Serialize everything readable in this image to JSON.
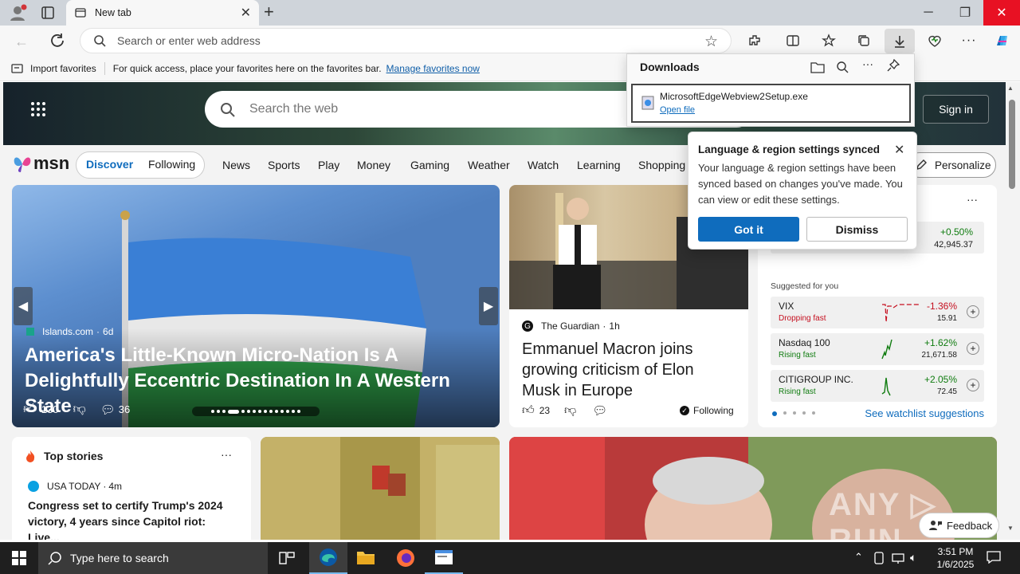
{
  "browser": {
    "tab_title": "New tab",
    "address_placeholder": "Search or enter web address",
    "import_favorites": "Import favorites",
    "favorites_hint": "For quick access, place your favorites here on the favorites bar.",
    "manage_favorites": "Manage favorites now"
  },
  "downloads": {
    "title": "Downloads",
    "file_name": "MicrosoftEdgeWebview2Setup.exe",
    "open_file": "Open file"
  },
  "sync_popup": {
    "title": "Language & region settings synced",
    "body": "Your language & region settings have been synced based on changes you've made. You can view or edit these settings.",
    "got_it": "Got it",
    "dismiss": "Dismiss"
  },
  "msn": {
    "search_placeholder": "Search the web",
    "sign_in": "Sign in",
    "logo": "msn",
    "tabs": [
      "Discover",
      "Following"
    ],
    "nav": [
      "News",
      "Sports",
      "Play",
      "Money",
      "Gaming",
      "Weather",
      "Watch",
      "Learning",
      "Shopping"
    ],
    "personalize": "Personalize"
  },
  "hero_card": {
    "source": "Islands.com",
    "age": "6d",
    "headline": "America's Little-Known Micro-Nation Is A Delightfully Eccentric Destination In A Western State",
    "likes": "130",
    "comments": "36"
  },
  "story_card": {
    "source": "The Guardian",
    "age": "1h",
    "headline": "Emmanuel Macron joins growing criticism of Elon Musk in Europe",
    "likes": "23",
    "following": "Following"
  },
  "watchlist": {
    "top_change": "+0.50%",
    "top_value": "42,945.37",
    "suggested": "Suggested for you",
    "stocks": [
      {
        "name": "VIX",
        "status": "Dropping fast",
        "change": "-1.36%",
        "value": "15.91"
      },
      {
        "name": "Nasdaq 100",
        "status": "Rising fast",
        "change": "+1.62%",
        "value": "21,671.58"
      },
      {
        "name": "CITIGROUP INC.",
        "status": "Rising fast",
        "change": "+2.05%",
        "value": "72.45"
      }
    ],
    "see_suggestions": "See watchlist suggestions"
  },
  "top_stories": {
    "title": "Top stories",
    "source": "USA TODAY",
    "age": "4m",
    "headline": "Congress set to certify Trump's 2024 victory, 4 years since Capitol riot: Live..."
  },
  "feedback": "Feedback",
  "taskbar": {
    "search_placeholder": "Type here to search",
    "time": "3:51 PM",
    "date": "1/6/2025"
  },
  "colors": {
    "accent": "#0f6cbd",
    "positive": "#107c10",
    "negative": "#c50f1f"
  }
}
